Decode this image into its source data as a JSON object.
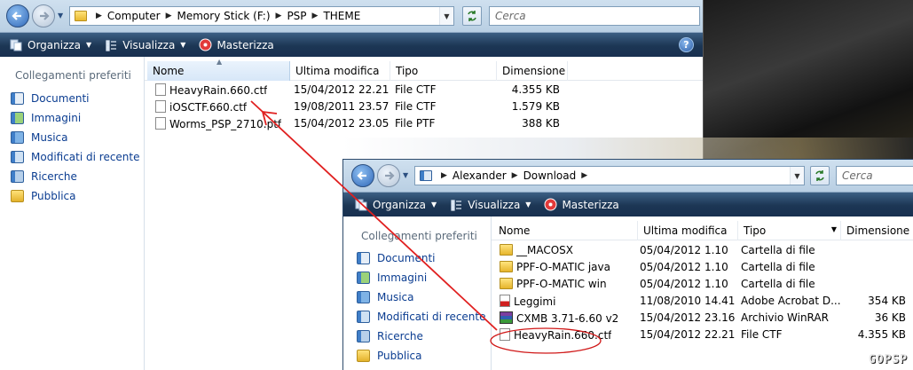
{
  "window1": {
    "breadcrumb": [
      "Computer",
      "Memory Stick (F:)",
      "PSP",
      "THEME"
    ],
    "search_placeholder": "Cerca",
    "toolbar": {
      "organizza": "Organizza",
      "visualizza": "Visualizza",
      "masterizza": "Masterizza"
    },
    "nav": {
      "heading": "Collegamenti preferiti",
      "items": [
        "Documenti",
        "Immagini",
        "Musica",
        "Modificati di recente",
        "Ricerche",
        "Pubblica"
      ]
    },
    "columns": {
      "name": "Nome",
      "modified": "Ultima modifica",
      "type": "Tipo",
      "size": "Dimensione"
    },
    "files": [
      {
        "name": "HeavyRain.660.ctf",
        "modified": "15/04/2012 22.21",
        "type": "File CTF",
        "size": "4.355 KB"
      },
      {
        "name": "iOSCTF.660.ctf",
        "modified": "19/08/2011 23.57",
        "type": "File CTF",
        "size": "1.579 KB"
      },
      {
        "name": "Worms_PSP_2710.ptf",
        "modified": "15/04/2012 23.05",
        "type": "File PTF",
        "size": "388 KB"
      }
    ]
  },
  "window2": {
    "breadcrumb": [
      "Alexander",
      "Download"
    ],
    "search_placeholder": "Cerca",
    "toolbar": {
      "organizza": "Organizza",
      "visualizza": "Visualizza",
      "masterizza": "Masterizza"
    },
    "nav": {
      "heading": "Collegamenti preferiti",
      "items": [
        "Documenti",
        "Immagini",
        "Musica",
        "Modificati di recente",
        "Ricerche",
        "Pubblica"
      ]
    },
    "columns": {
      "name": "Nome",
      "modified": "Ultima modifica",
      "type": "Tipo",
      "size": "Dimensione"
    },
    "files": [
      {
        "name": "__MACOSX",
        "modified": "05/04/2012 1.10",
        "type": "Cartella di file",
        "size": ""
      },
      {
        "name": "PPF-O-MATIC java",
        "modified": "05/04/2012 1.10",
        "type": "Cartella di file",
        "size": ""
      },
      {
        "name": "PPF-O-MATIC win",
        "modified": "05/04/2012 1.10",
        "type": "Cartella di file",
        "size": ""
      },
      {
        "name": "Leggimi",
        "modified": "11/08/2010 14.41",
        "type": "Adobe Acrobat D...",
        "size": "354 KB"
      },
      {
        "name": "CXMB 3.71-6.60 v2",
        "modified": "15/04/2012 23.16",
        "type": "Archivio WinRAR",
        "size": "36 KB"
      },
      {
        "name": "HeavyRain.660.ctf",
        "modified": "15/04/2012 22.21",
        "type": "File CTF",
        "size": "4.355 KB"
      }
    ]
  },
  "annotation": {
    "arrow_color": "#e02020",
    "ellipse_color": "#d01818"
  },
  "watermark": "GOPSP"
}
